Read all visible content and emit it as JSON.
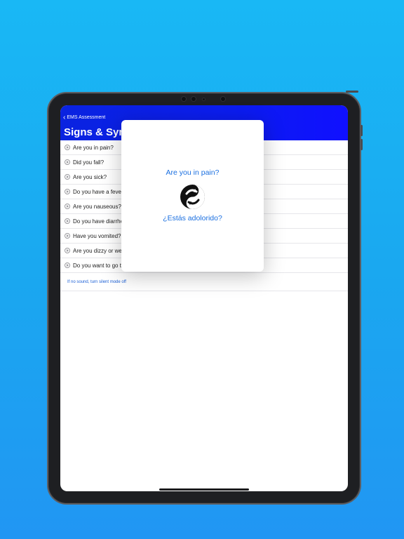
{
  "nav": {
    "back_label": "EMS Assessment",
    "title": "Signs & Symptoms"
  },
  "list": {
    "items": [
      {
        "label": "Are you in pain?"
      },
      {
        "label": "Did you fall?"
      },
      {
        "label": "Are you sick?"
      },
      {
        "label": "Do you have a fever?"
      },
      {
        "label": "Are you nauseous?"
      },
      {
        "label": "Do you have diarrhea?"
      },
      {
        "label": "Have you vomited?"
      },
      {
        "label": "Are you dizzy or weak?"
      },
      {
        "label": "Do you want to go to the hospital?"
      }
    ],
    "note": "If no sound, turn silent mode off"
  },
  "modal": {
    "english": "Are you in pain?",
    "spanish": "¿Estás adolorido?",
    "logo_icon": "translate-swap-icon"
  },
  "colors": {
    "background": "#1aa8f0",
    "header": "#0b1cf0",
    "link": "#1a6fe0"
  }
}
